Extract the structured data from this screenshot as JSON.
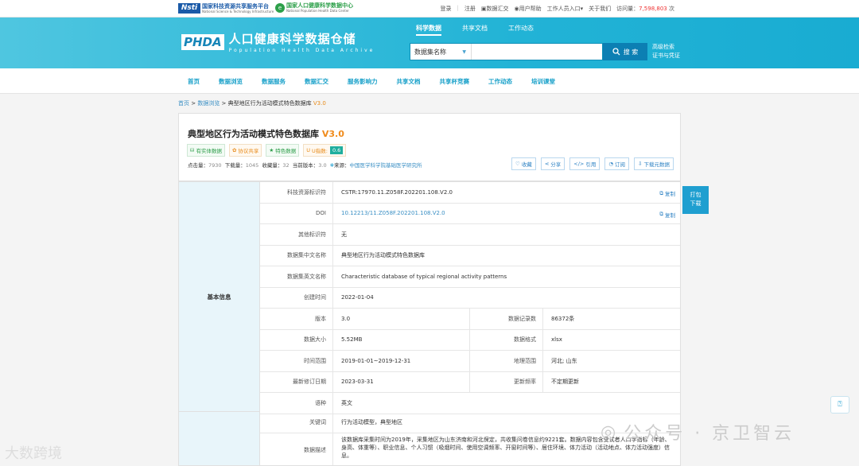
{
  "topbar": {
    "logo1_abbr": "Nsti",
    "logo1_cn": "国家科技资源共享服务平台",
    "logo1_en": "National Science & Technology Infrastructure",
    "logo2_cn": "国家人口健康科学数据中心",
    "logo2_en": "National Population Health Data Center",
    "links": {
      "login": "登录",
      "register": "注册",
      "data_collect": "数据汇交",
      "help": "用户帮助",
      "staff": "工作人员入口",
      "about": "关于我们"
    },
    "visits_label": "访问量：",
    "visits_value": "7,598,803",
    "visits_unit": "次"
  },
  "banner": {
    "abbr": "PHDA",
    "title_cn": "人口健康科学数据仓储",
    "title_en": "Population  Health  Data  Archive",
    "tabs": [
      "科学数据",
      "共享文档",
      "工作动态"
    ],
    "search_select": "数据集名称",
    "search_button": "搜 索",
    "advanced": "高级检索",
    "cert": "证书与凭证"
  },
  "nav": [
    "首页",
    "数据浏览",
    "数据服务",
    "数据汇交",
    "服务影响力",
    "共享文档",
    "共享杯竞赛",
    "工作动态",
    "培训课堂"
  ],
  "breadcrumb": {
    "home": "首页",
    "browse": "数据浏览",
    "current": "典型地区行为活动模式特色数据库",
    "version": "V3.0"
  },
  "dataset": {
    "title": "典型地区行为活动模式特色数据库",
    "version": "V3.0",
    "tags": [
      "有实体数据",
      "协议共享",
      "特色数据"
    ],
    "u_label": "U指数:",
    "u_value": "0.6",
    "stats": {
      "clicks_label": "点击量：",
      "clicks": "7930",
      "downloads_label": "下载量：",
      "downloads": "1045",
      "favorites_label": "收藏量：",
      "favorites": "32",
      "version_label": "当前版本：",
      "version": "3.0",
      "source_label": "来源：",
      "source": "中国医学科学院基础医学研究所"
    },
    "actions": [
      "收藏",
      "分享",
      "引用",
      "订阅",
      "下载元数据"
    ]
  },
  "float_button": {
    "line1": "打包",
    "line2": "下载"
  },
  "copy_label": "复制",
  "basic_group": "基本信息",
  "rows": {
    "cstr_label": "科技资源标识符",
    "cstr": "CSTR:17970.11.Z058F.202201.108.V2.0",
    "doi_label": "DOI",
    "doi": "10.12213/11.Z058F.202201.108.V2.0",
    "other_label": "其他标识符",
    "other": "无",
    "cn_name_label": "数据集中文名称",
    "cn_name": "典型地区行为活动模式特色数据库",
    "en_name_label": "数据集英文名称",
    "en_name": "Characteristic database of typical regional activity patterns",
    "created_label": "创建时间",
    "created": "2022-01-04",
    "version_label": "版本",
    "version": "3.0",
    "records_label": "数据记录数",
    "records": "86372条",
    "size_label": "数据大小",
    "size": "5.52MB",
    "format_label": "数据格式",
    "format": "xlsx",
    "time_label": "时间范围",
    "time": "2019-01-01~2019-12-31",
    "geo_label": "地理范围",
    "geo": "河北; 山东",
    "modified_label": "最新修订日期",
    "modified": "2023-03-31",
    "freq_label": "更新频率",
    "freq": "不定期更新",
    "lang_label": "语种",
    "lang": "英文",
    "keywords_label": "关键词",
    "keywords": "行为活动模型，典型地区",
    "desc_label": "数据描述",
    "desc": "该数据库采集时间为2019年，采集地区为山东济南和河北保定，共收集问卷信息约9221套。数据内容包含受试者人口学指标（年龄、身高、体重等）、职业信息、个人习惯（吸烟时间、使用空调频率、开窗时间等）、居住环境、体力活动（活动地点、体力活动强度）信息。"
  },
  "watermark": {
    "wm1": "公众号 · 京卫智云",
    "wm2": "大数跨境"
  }
}
